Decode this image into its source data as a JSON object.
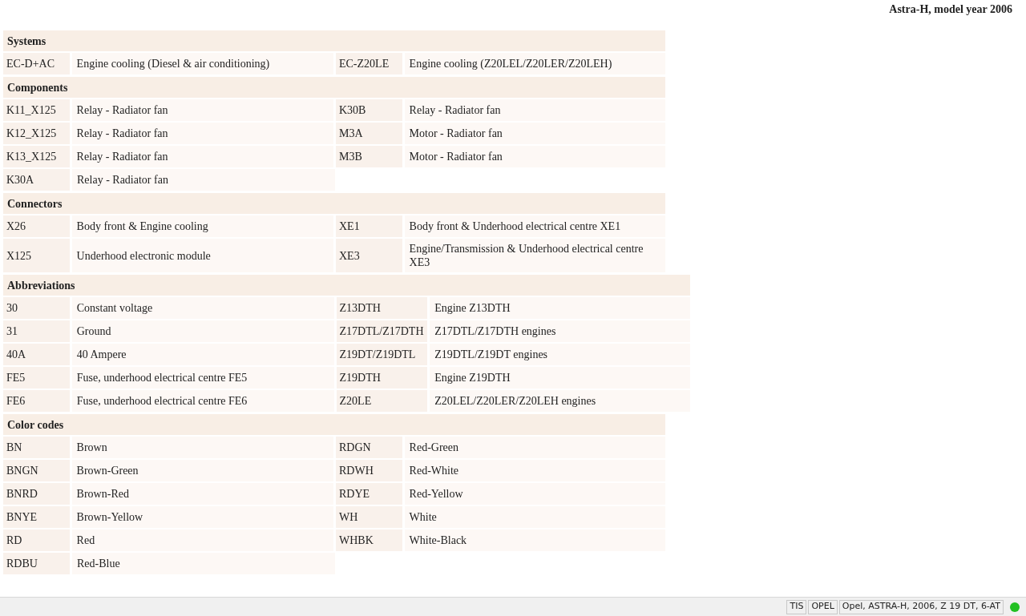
{
  "page_title": "Astra-H, model year 2006",
  "sections": [
    {
      "title": "Systems",
      "kind": "standard",
      "rows": [
        [
          {
            "code": "EC-D+AC",
            "desc": "Engine cooling (Diesel & air conditioning)"
          },
          {
            "code": "EC-Z20LE",
            "desc": "Engine cooling (Z20LEL/Z20LER/Z20LEH)"
          }
        ]
      ]
    },
    {
      "title": "Components",
      "kind": "standard",
      "rows": [
        [
          {
            "code": "K11_X125",
            "desc": "Relay - Radiator fan"
          },
          {
            "code": "K30B",
            "desc": "Relay - Radiator fan"
          }
        ],
        [
          {
            "code": "K12_X125",
            "desc": "Relay - Radiator fan"
          },
          {
            "code": "M3A",
            "desc": "Motor - Radiator fan"
          }
        ],
        [
          {
            "code": "K13_X125",
            "desc": "Relay - Radiator fan"
          },
          {
            "code": "M3B",
            "desc": "Motor - Radiator fan"
          }
        ],
        [
          {
            "code": "K30A",
            "desc": "Relay - Radiator fan"
          }
        ]
      ]
    },
    {
      "title": "Connectors",
      "kind": "standard",
      "rows": [
        [
          {
            "code": "X26",
            "desc": "Body front & Engine cooling"
          },
          {
            "code": "XE1",
            "desc": "Body front & Underhood electrical centre XE1"
          }
        ],
        [
          {
            "code": "X125",
            "desc": "Underhood electronic module"
          },
          {
            "code": "XE3",
            "desc": "Engine/Transmission & Underhood electrical centre XE3"
          }
        ]
      ]
    },
    {
      "title": "Abbreviations",
      "kind": "wide",
      "rows": [
        [
          {
            "code": "30",
            "desc": "Constant voltage"
          },
          {
            "code": "Z13DTH",
            "desc": "Engine Z13DTH"
          }
        ],
        [
          {
            "code": "31",
            "desc": "Ground"
          },
          {
            "code": "Z17DTL/Z17DTH",
            "desc": "Z17DTL/Z17DTH engines"
          }
        ],
        [
          {
            "code": "40A",
            "desc": "40 Ampere"
          },
          {
            "code": "Z19DT/Z19DTL",
            "desc": "Z19DTL/Z19DT engines"
          }
        ],
        [
          {
            "code": "FE5",
            "desc": "Fuse, underhood electrical centre FE5"
          },
          {
            "code": "Z19DTH",
            "desc": "Engine Z19DTH"
          }
        ],
        [
          {
            "code": "FE6",
            "desc": "Fuse, underhood electrical centre FE6"
          },
          {
            "code": "Z20LE",
            "desc": "Z20LEL/Z20LER/Z20LEH engines"
          }
        ]
      ]
    },
    {
      "title": "Color codes",
      "kind": "standard",
      "rows": [
        [
          {
            "code": "BN",
            "desc": "Brown"
          },
          {
            "code": "RDGN",
            "desc": "Red-Green"
          }
        ],
        [
          {
            "code": "BNGN",
            "desc": "Brown-Green"
          },
          {
            "code": "RDWH",
            "desc": "Red-White"
          }
        ],
        [
          {
            "code": "BNRD",
            "desc": "Brown-Red"
          },
          {
            "code": "RDYE",
            "desc": "Red-Yellow"
          }
        ],
        [
          {
            "code": "BNYE",
            "desc": "Brown-Yellow"
          },
          {
            "code": "WH",
            "desc": "White"
          }
        ],
        [
          {
            "code": "RD",
            "desc": "Red"
          },
          {
            "code": "WHBK",
            "desc": "White-Black"
          }
        ],
        [
          {
            "code": "RDBU",
            "desc": "Red-Blue"
          }
        ]
      ]
    }
  ],
  "status_bar": {
    "fields": [
      "TIS",
      "OPEL",
      "Opel, ASTRA-H, 2006, Z 19 DT, 6-AT"
    ],
    "connected": true
  }
}
